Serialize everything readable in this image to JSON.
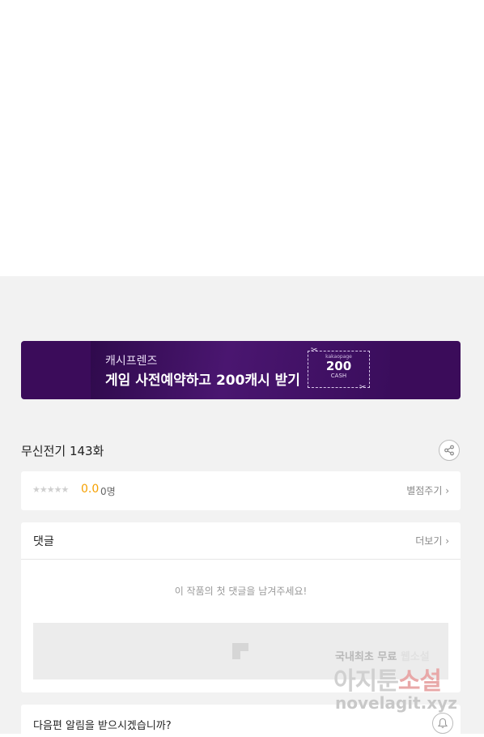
{
  "banner": {
    "subtitle": "캐시프렌즈",
    "title": "게임 사전예약하고 200캐시 받기",
    "coupon_brand": "kakaopage",
    "coupon_amount": "200",
    "coupon_unit": "CASH"
  },
  "episode": {
    "title": "무신전기 143화"
  },
  "rating": {
    "stars": "★★★★★",
    "score": "0.0",
    "count": "0명",
    "rate_link": "별점주기 ›"
  },
  "comments": {
    "heading": "댓글",
    "more_link": "더보기 ›",
    "empty_message": "이 작품의 첫 댓글을 남겨주세요!"
  },
  "notify": {
    "text": "다음편 알림을 받으시겠습니까?"
  },
  "watermark": {
    "line1_a": "국내최초 무료 ",
    "line1_b": "웹소설",
    "line2_a": "아지툰",
    "line2_b": "소설",
    "line3": "novelagit.xyz"
  },
  "colors": {
    "banner_bg": "#3b0c5a",
    "score": "#f5a000",
    "page_bg": "#f2f2f2"
  }
}
